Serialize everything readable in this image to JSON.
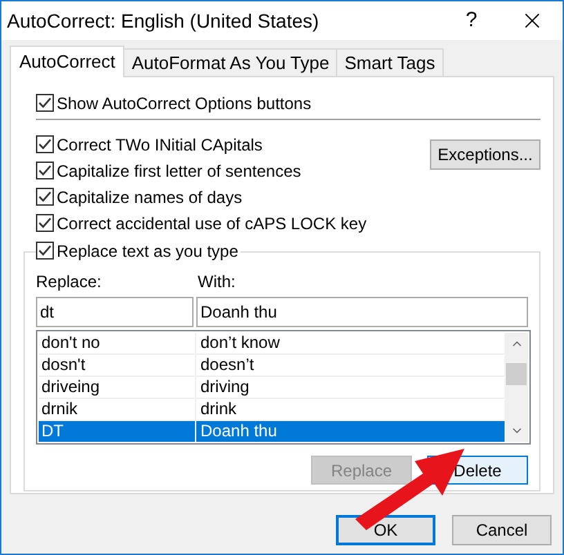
{
  "window": {
    "title": "AutoCorrect: English (United States)",
    "help": "?"
  },
  "tabs": [
    {
      "label": "AutoCorrect",
      "selected": true
    },
    {
      "label": "AutoFormat As You Type",
      "selected": false
    },
    {
      "label": "Smart Tags",
      "selected": false
    }
  ],
  "show_options": {
    "label": "Show AutoCorrect Options buttons",
    "checked": true
  },
  "options": [
    {
      "label": "Correct TWo INitial CApitals",
      "checked": true
    },
    {
      "label": "Capitalize first letter of sentences",
      "checked": true
    },
    {
      "label": "Capitalize names of days",
      "checked": true
    },
    {
      "label": "Correct accidental use of cAPS LOCK key",
      "checked": true
    }
  ],
  "exceptions_button": "Exceptions...",
  "replace_group": {
    "label": "Replace text as you type",
    "checked": true
  },
  "replace_label": "Replace:",
  "with_label": "With:",
  "replace_value": "dt",
  "with_value": "Doanh thu",
  "entries": [
    {
      "replace": "don't no",
      "with": "don’t know",
      "selected": false
    },
    {
      "replace": "dosn't",
      "with": "doesn’t",
      "selected": false
    },
    {
      "replace": "driveing",
      "with": "driving",
      "selected": false
    },
    {
      "replace": "drnik",
      "with": "drink",
      "selected": false
    },
    {
      "replace": "DT",
      "with": "Doanh thu",
      "selected": true
    }
  ],
  "replace_button": {
    "label": "Replace",
    "disabled": true
  },
  "delete_button": {
    "label": "Delete",
    "focused": true
  },
  "ok_button": {
    "label": "OK",
    "default": true
  },
  "cancel_button": "Cancel"
}
